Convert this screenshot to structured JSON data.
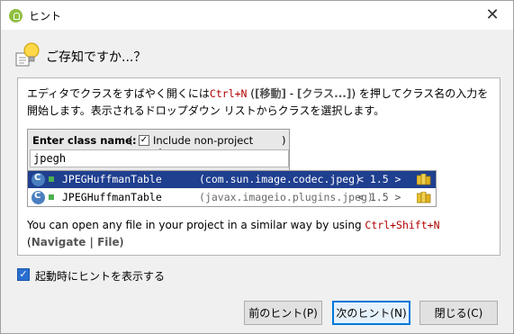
{
  "window": {
    "title": "ヒント",
    "close_glyph": "✕"
  },
  "header": {
    "title": "ご存知ですか...？"
  },
  "description": {
    "part1": "エディタでクラスをすばやく開くには",
    "shortcut1": "Ctrl+N",
    "part2": " (",
    "menu1": "[移動]",
    "part3": " - ",
    "menu2": "[クラス...]",
    "part4": ") を押してクラス名の入力を開始します。表示されるドロップダウン リストからクラスを選択します。"
  },
  "popup": {
    "enter_label": "Enter class name:",
    "paren_open": "(",
    "paren_close": ")",
    "include_checked": true,
    "include_label": "Include non-project classes",
    "search_value": "jpegh",
    "results": [
      {
        "name": "JPEGHuffmanTable",
        "package": "(com.sun.image.codec.jpeg)",
        "version": "< 1.5 >",
        "selected": true
      },
      {
        "name": "JPEGHuffmanTable",
        "package": "(javax.imageio.plugins.jpeg)",
        "version": "< 1.5 >",
        "selected": false
      }
    ]
  },
  "description2": {
    "part1": "You can open any file in your project in a similar way by using ",
    "shortcut": "Ctrl+Shift+N",
    "part2": "(",
    "nav": "Navigate",
    "sep": " | ",
    "file": "File",
    "part3": ")"
  },
  "footer": {
    "startup_checked": true,
    "startup_label": "起動時にヒントを表示する",
    "prev_button": "前のヒント(P)",
    "next_button": "次のヒント(N)",
    "close_button": "閉じる(C)"
  },
  "colors": {
    "accent": "#0078d7",
    "selection": "#1f3f8f",
    "shortcut": "#b00000"
  }
}
